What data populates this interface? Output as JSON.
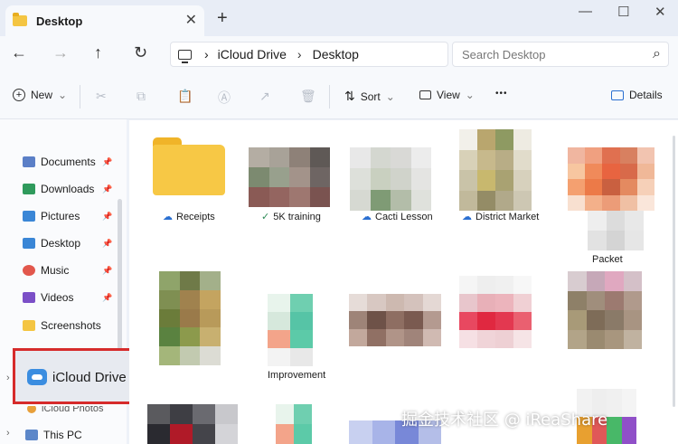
{
  "window": {
    "tab_title": "Desktop",
    "tab_close": "✕",
    "new_tab": "+",
    "minimize": "—",
    "maximize": "☐",
    "close": "✕"
  },
  "address": {
    "back": "←",
    "forward": "→",
    "up": "↑",
    "refresh": "↻",
    "separator": "›",
    "crumbs": [
      "iCloud Drive",
      "Desktop"
    ],
    "search_placeholder": "Search Desktop",
    "search_icon": "⌕"
  },
  "toolbar": {
    "new_label": "New",
    "sort_label": "Sort",
    "view_label": "View",
    "more_label": "•••",
    "details_label": "Details",
    "cut_icon": "✂",
    "copy_icon": "⧉",
    "paste_icon": "📋",
    "rename_icon": "Ⓐ",
    "share_icon": "↗",
    "delete_icon": "🗑",
    "chevron": "⌄"
  },
  "sidebar": {
    "items": [
      {
        "label": "Documents",
        "icon": "documents-icon",
        "color": "#5b7fc7"
      },
      {
        "label": "Downloads",
        "icon": "downloads-icon",
        "color": "#2f9a5c"
      },
      {
        "label": "Pictures",
        "icon": "pictures-icon",
        "color": "#3a86d6"
      },
      {
        "label": "Desktop",
        "icon": "desktop-icon",
        "color": "#3a86d6"
      },
      {
        "label": "Music",
        "icon": "music-icon",
        "color": "#e2574c"
      },
      {
        "label": "Videos",
        "icon": "videos-icon",
        "color": "#7b4fc7"
      },
      {
        "label": "Screenshots",
        "icon": "folder-icon",
        "color": "#f4c542"
      }
    ],
    "pin": "📌",
    "icloud_drive": "iCloud Drive",
    "icloud_photos": "iCloud Photos",
    "this_pc": "This PC"
  },
  "files": [
    {
      "name": "Receipts",
      "status": "☁"
    },
    {
      "name": "5K training",
      "status": "✓"
    },
    {
      "name": "Cacti Lesson",
      "status": "☁"
    },
    {
      "name": "District Market",
      "status": "☁"
    },
    {
      "name": "Packet",
      "status": ""
    },
    {
      "name": "",
      "status": ""
    },
    {
      "name": "Improvement",
      "status": ""
    },
    {
      "name": "",
      "status": ""
    },
    {
      "name": "",
      "status": ""
    },
    {
      "name": "",
      "status": ""
    }
  ],
  "watermark": "掘金技术社区 @ iReaShare"
}
